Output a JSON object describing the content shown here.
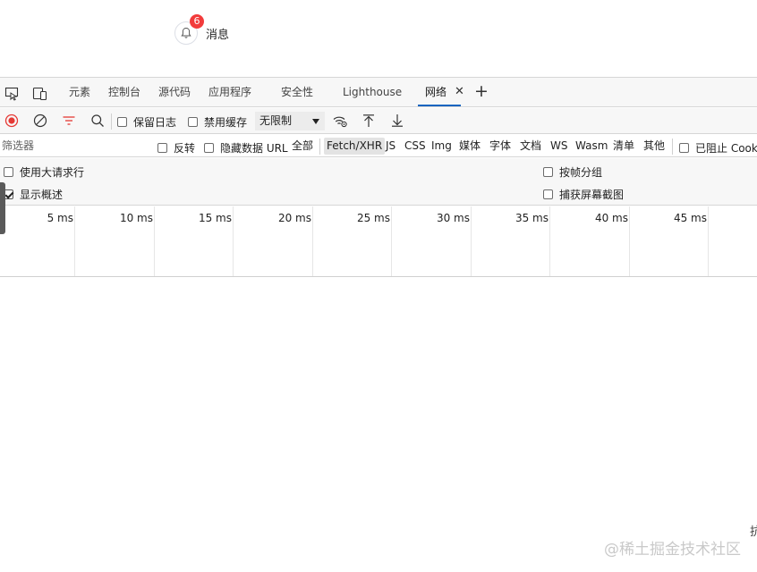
{
  "notification": {
    "badge_count": "6",
    "label": "消息"
  },
  "devtools": {
    "tabs": [
      {
        "label": "元素",
        "active": false
      },
      {
        "label": "控制台",
        "active": false
      },
      {
        "label": "源代码",
        "active": false
      },
      {
        "label": "应用程序",
        "active": false
      },
      {
        "label": "安全性",
        "active": false
      },
      {
        "label": "Lighthouse",
        "active": false
      },
      {
        "label": "网络",
        "active": true
      }
    ],
    "tab_close_glyph": "✕",
    "tab_add_glyph": "+",
    "toolbar": {
      "preserve_log_label": "保留日志",
      "disable_cache_label": "禁用缓存",
      "throttle_value": "无限制"
    },
    "filter": {
      "placeholder": "筛选器",
      "invert_label": "反转",
      "hide_data_url_label": "隐藏数据 URL",
      "types": [
        "全部",
        "Fetch/XHR",
        "JS",
        "CSS",
        "Img",
        "媒体",
        "字体",
        "文档",
        "WS",
        "Wasm",
        "清单",
        "其他"
      ],
      "active_type": "Fetch/XHR",
      "blocked_cookies_label": "已阻止 Cooki"
    },
    "settings": {
      "large_rows_label": "使用大请求行",
      "group_by_frame_label": "按帧分组",
      "show_overview_label": "显示概述",
      "show_overview_checked": true,
      "capture_screenshots_label": "捕获屏幕截图"
    },
    "timeline_ticks": [
      "5 ms",
      "10 ms",
      "15 ms",
      "20 ms",
      "25 ms",
      "30 ms",
      "35 ms",
      "40 ms",
      "45 ms"
    ]
  },
  "watermark": "@稀土掘金技术社区",
  "edge_text": "抗",
  "icons": {
    "inspect": "inspect-element-icon",
    "device": "device-toolbar-icon",
    "record": "record-icon",
    "clear": "clear-icon",
    "filter": "filter-icon",
    "search": "search-icon",
    "network_conditions": "network-conditions-icon",
    "import": "import-har-icon",
    "export": "export-har-icon",
    "bell": "bell-icon"
  },
  "colors": {
    "record_red": "#e53935",
    "accent_blue": "#1565c0",
    "badge_red": "#f23b3b"
  }
}
